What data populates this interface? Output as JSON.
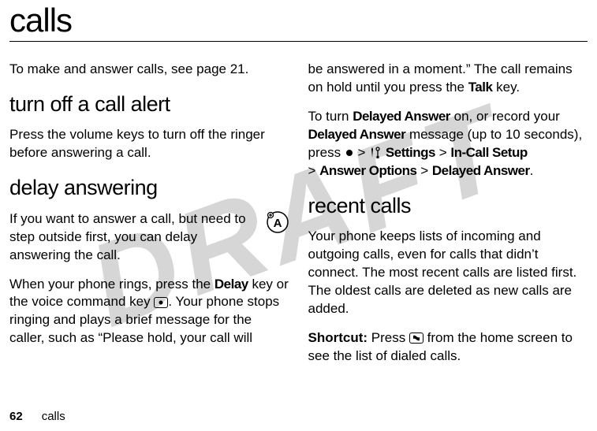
{
  "watermark": "DRAFT",
  "title": "calls",
  "col1": {
    "intro": "To make and answer calls, see page 21.",
    "section1_heading": "turn off a call alert",
    "section1_body": "Press the volume keys to turn off the ringer before answering a call.",
    "section2_heading": "delay answering",
    "section2_p1": "If you want to answer a call, but need to step outside first, you can delay answering the call.",
    "section2_p2_a": "When your phone rings, press the ",
    "section2_delay": "Delay",
    "section2_p2_b": " key or the voice command key ",
    "section2_p2_c": ". Your phone stops ringing and plays a brief message for the caller, such as “Please hold, your call will"
  },
  "col2": {
    "p1_a": "be answered in a moment.” The call remains on hold until you press the ",
    "talk": "Talk",
    "p1_b": " key.",
    "p2_a": "To turn ",
    "delayed_answer1": "Delayed Answer",
    "p2_b": " on, or record your ",
    "delayed_answer2": "Delayed Answer",
    "p2_c": " message (up to 10 seconds), press ",
    "gt1": " > ",
    "settings": "Settings",
    "gt2": " > ",
    "incall": "In-Call Setup",
    "gt3": " > ",
    "answer_options": "Answer Options",
    "gt4": " > ",
    "delayed_answer3": "Delayed Answer",
    "period": ".",
    "section_heading": "recent calls",
    "p3": "Your phone keeps lists of incoming and outgoing calls, even for calls that didn’t connect. The most recent calls are listed first. The oldest calls are deleted as new calls are added.",
    "p4_a": "Shortcut:",
    "p4_b": " Press ",
    "p4_c": " from the home screen to see the list of dialed calls."
  },
  "footer": {
    "page": "62",
    "label": "calls"
  },
  "icons": {
    "voice_key": "•",
    "send_key": "•"
  }
}
